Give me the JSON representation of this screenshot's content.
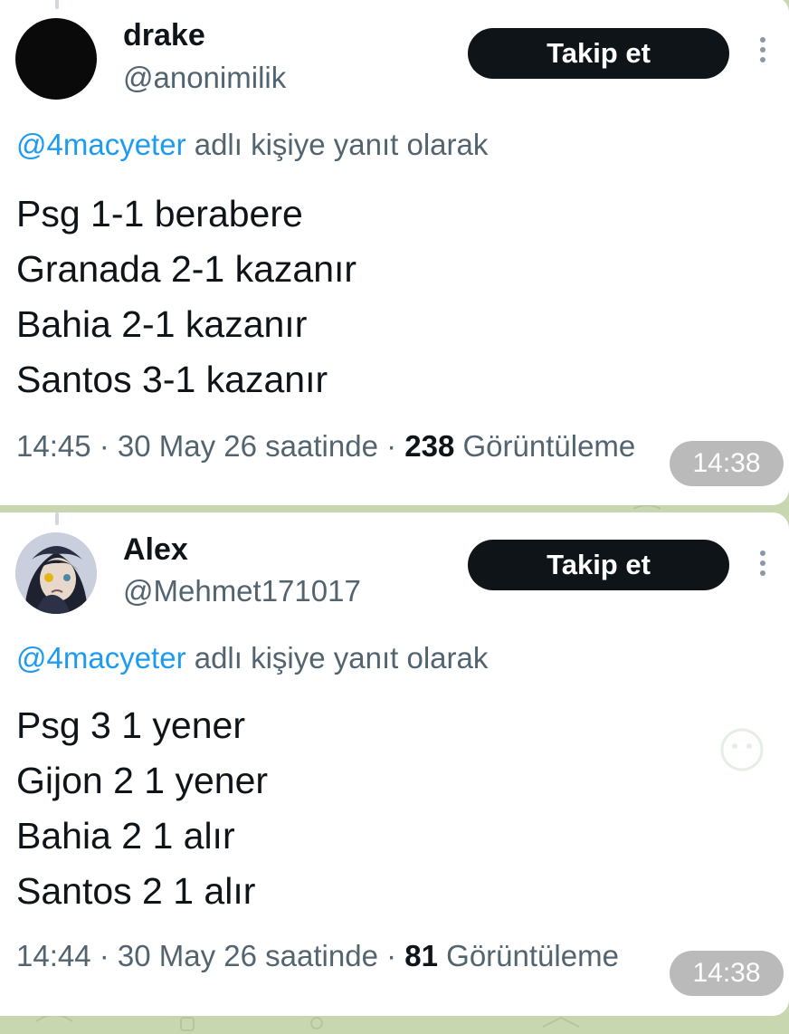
{
  "colors": {
    "background": "#c9d7b0",
    "card": "#ffffff",
    "follow_button": "#0f1419",
    "mention": "#1d9bf0",
    "secondary_text": "#536471"
  },
  "posts": [
    {
      "display_name": "drake",
      "handle": "@anonimilik",
      "avatar": "black-avatar",
      "follow_label": "Takip et",
      "reply_mention": "@4macyeter",
      "reply_suffix": " adlı kişiye yanıt olarak",
      "lines": [
        "Psg 1-1 berabere",
        "Granada 2-1 kazanır",
        "Bahia 2-1 kazanır",
        "Santos 3-1 kazanır"
      ],
      "timestamp": "14:45 · 30 May 26 saatinde · ",
      "views": "238",
      "views_label": " Görüntüleme",
      "message_time": "14:38"
    },
    {
      "display_name": "Alex",
      "handle": "@Mehmet171017",
      "avatar": "anime-character-avatar",
      "follow_label": "Takip et",
      "reply_mention": "@4macyeter",
      "reply_suffix": " adlı kişiye yanıt olarak",
      "lines": [
        "Psg 3 1 yener",
        "Gijon 2 1 yener",
        "Bahia 2 1 alır",
        "Santos 2 1 alır"
      ],
      "timestamp": "14:44 · 30 May 26 saatinde · ",
      "views": "81",
      "views_label": " Görüntüleme",
      "message_time": "14:38"
    }
  ]
}
